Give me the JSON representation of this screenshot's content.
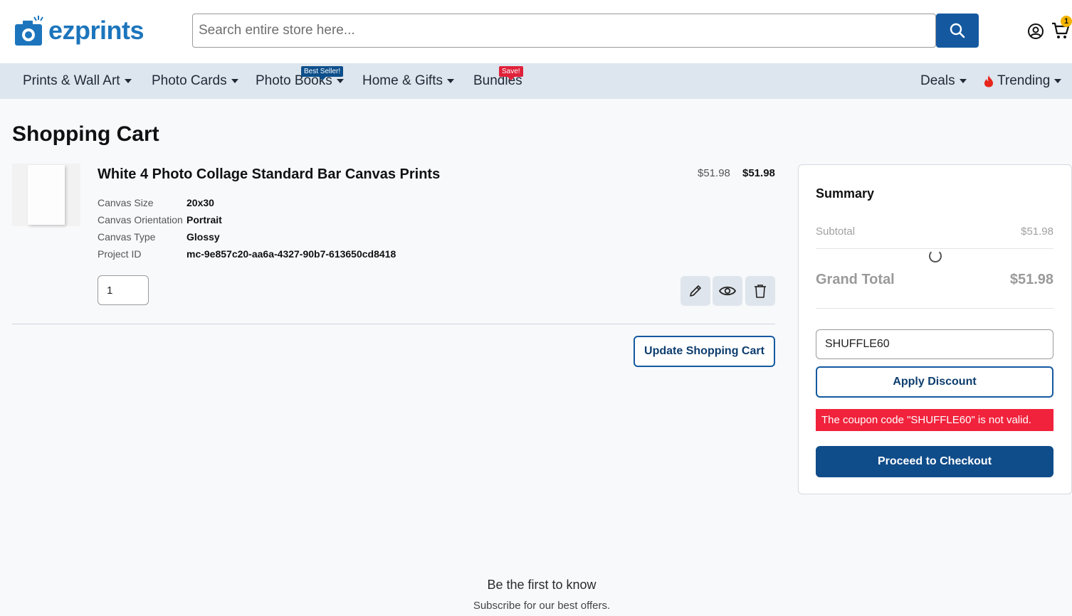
{
  "header": {
    "logo_text": "ezprints",
    "search_placeholder": "Search entire store here...",
    "cart_count": "1"
  },
  "nav": {
    "items": [
      {
        "label": "Prints & Wall Art"
      },
      {
        "label": "Photo Cards"
      },
      {
        "label": "Photo Books",
        "tag": "Best Seller!"
      },
      {
        "label": "Home & Gifts"
      },
      {
        "label": "Bundles",
        "tag": "Save!"
      },
      {
        "label": "Deals"
      },
      {
        "label": "Trending"
      }
    ]
  },
  "page": {
    "title": "Shopping Cart"
  },
  "cart_item": {
    "name": "White 4 Photo Collage Standard Bar Canvas Prints",
    "price_original": "$51.98",
    "price_final": "$51.98",
    "options": [
      {
        "label": "Canvas Size",
        "value": "20x30"
      },
      {
        "label": "Canvas Orientation",
        "value": "Portrait"
      },
      {
        "label": "Canvas Type",
        "value": "Glossy"
      },
      {
        "label": "Project ID",
        "value": "mc-9e857c20-aa6a-4327-90b7-613650cd8418"
      }
    ],
    "quantity": "1"
  },
  "cart_actions": {
    "update_label": "Update Shopping Cart"
  },
  "summary": {
    "title": "Summary",
    "subtotal_label": "Subtotal",
    "subtotal_value": "$51.98",
    "grand_total_label": "Grand Total",
    "grand_total_value": "$51.98",
    "coupon_value": "SHUFFLE60",
    "apply_label": "Apply Discount",
    "error_message": "The coupon code \"SHUFFLE60\" is not valid.",
    "checkout_label": "Proceed to Checkout"
  },
  "footer": {
    "title": "Be the first to know",
    "subtitle": "Subscribe for our best offers."
  },
  "colors": {
    "brand_blue": "#1c75bc",
    "button_blue": "#1459a0",
    "nav_bg": "#dde5ee",
    "error_red": "#f1223c"
  }
}
